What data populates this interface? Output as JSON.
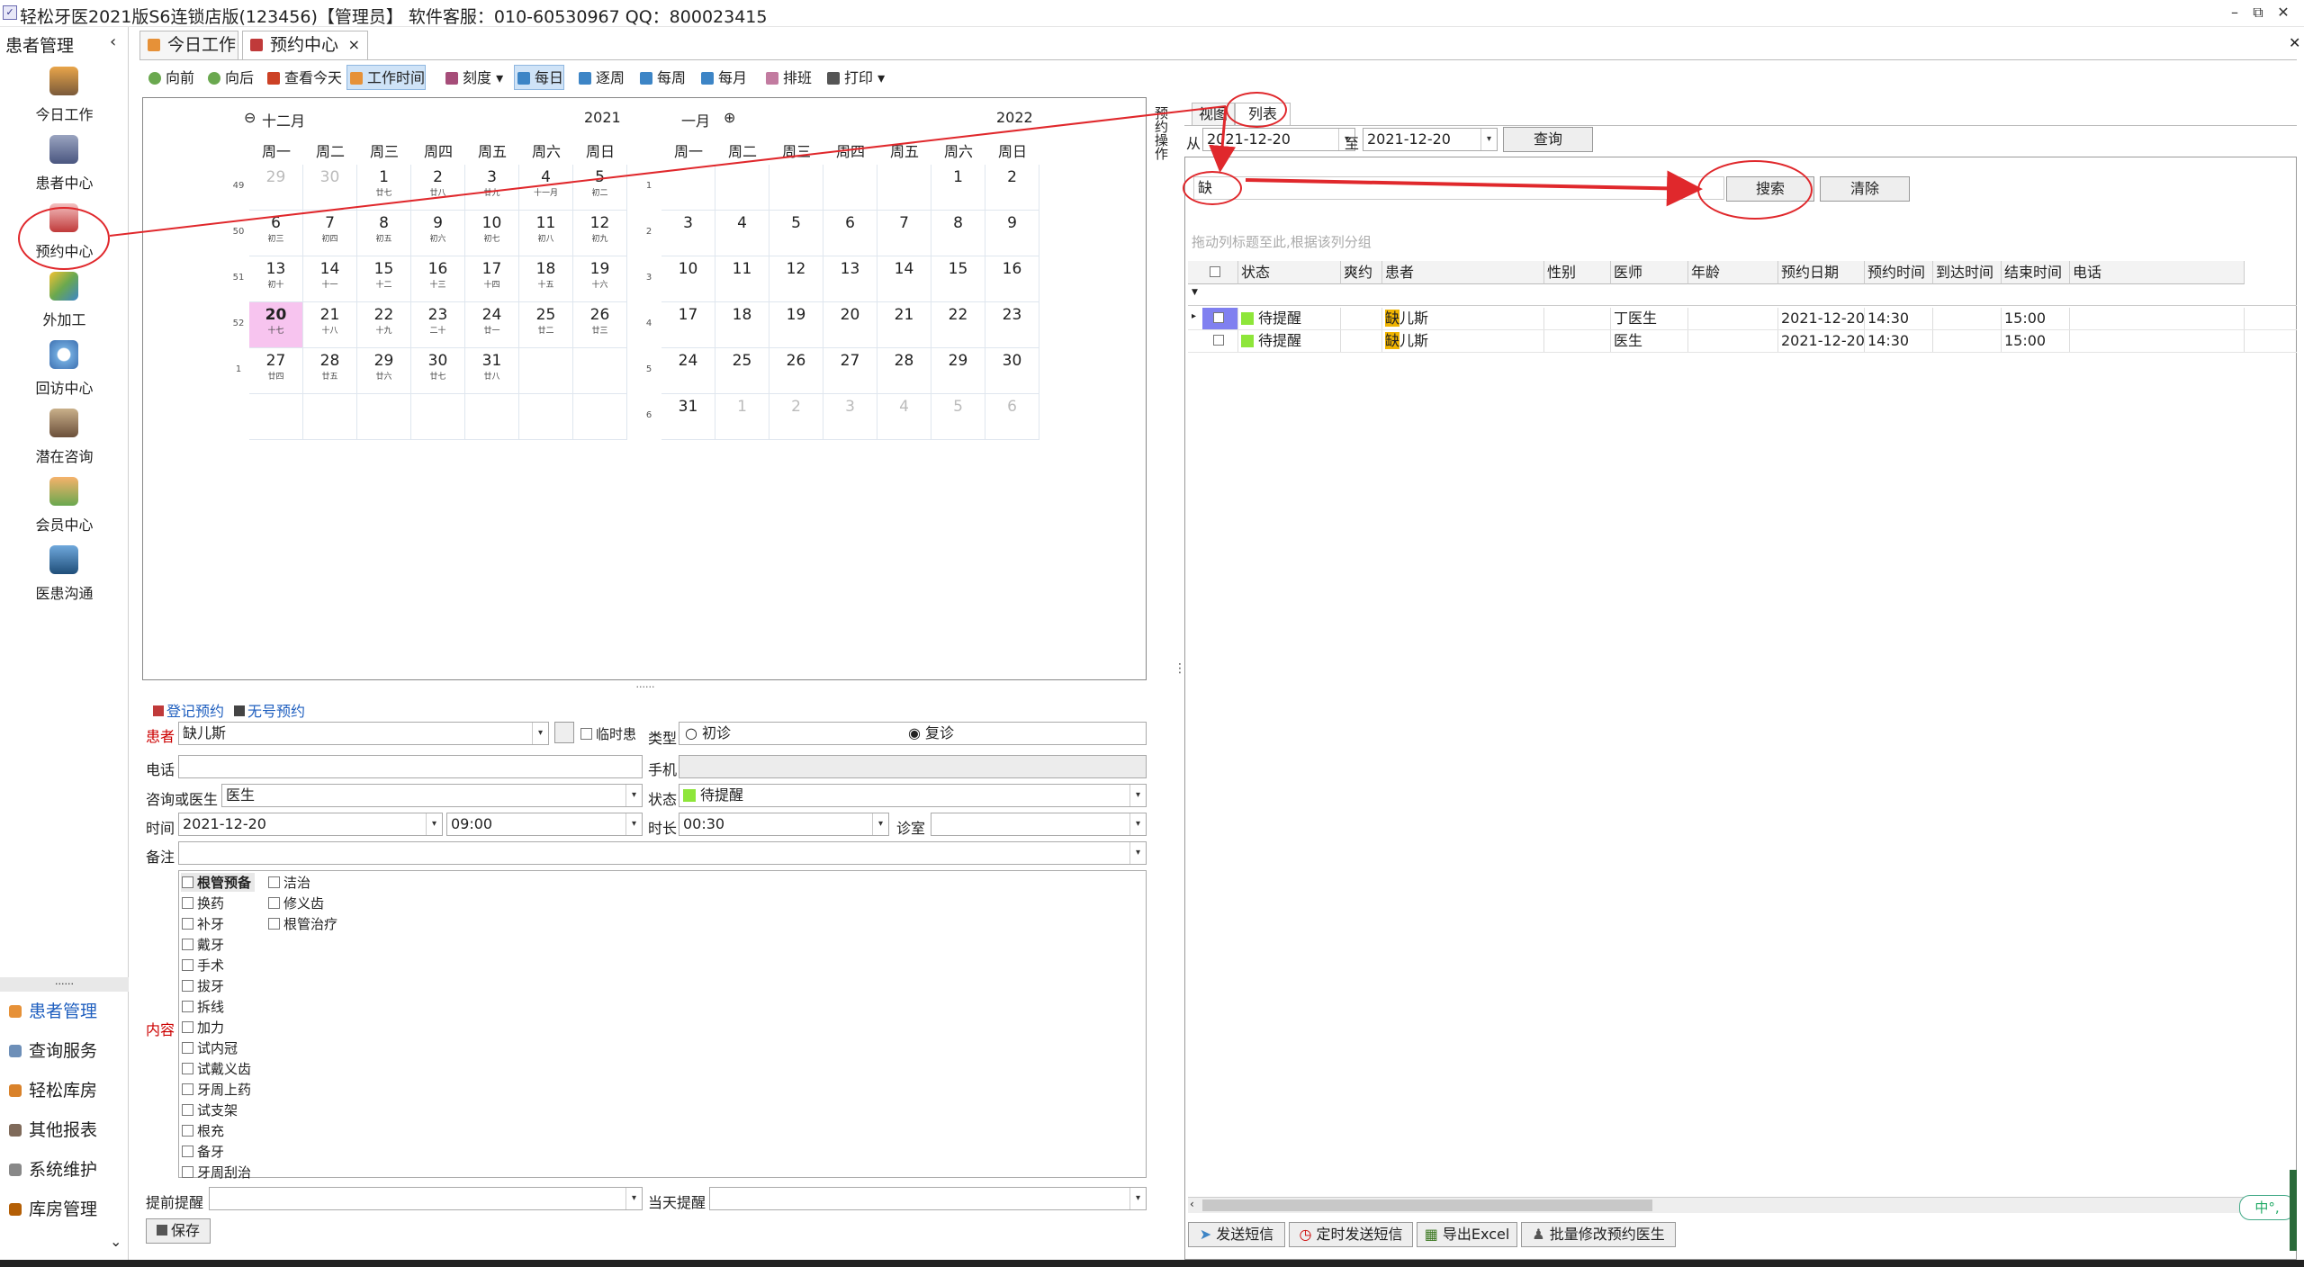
{
  "window": {
    "title": "轻松牙医2021版S6连锁店版(123456)【管理员】   软件客服：010-60530967 QQ：800023415"
  },
  "sidebar": {
    "header": "患者管理",
    "collapse": "‹",
    "items": [
      {
        "label": "今日工作"
      },
      {
        "label": "患者中心"
      },
      {
        "label": "预约中心"
      },
      {
        "label": "外加工"
      },
      {
        "label": "回访中心"
      },
      {
        "label": "潜在咨询"
      },
      {
        "label": "会员中心"
      },
      {
        "label": "医患沟通"
      }
    ],
    "grip": "......",
    "bottom": [
      {
        "label": "患者管理"
      },
      {
        "label": "查询服务"
      },
      {
        "label": "轻松库房"
      },
      {
        "label": "其他报表"
      },
      {
        "label": "系统维护"
      },
      {
        "label": "库房管理"
      }
    ],
    "expand": "⌄"
  },
  "tabs": [
    {
      "label": "今日工作"
    },
    {
      "label": "预约中心",
      "close": "×"
    }
  ],
  "toolbar": {
    "prev": "向前",
    "next": "向后",
    "today": "查看今天",
    "worktime": "工作时间",
    "scale": "刻度",
    "daily": "每日",
    "byweek": "逐周",
    "weekly": "每周",
    "monthly": "每月",
    "schedule": "排班",
    "print": "打印"
  },
  "calendar": {
    "left": {
      "month": "十二月",
      "year": "2021"
    },
    "right": {
      "month": "一月",
      "year": "2022"
    },
    "weekdays": [
      "周一",
      "周二",
      "周三",
      "周四",
      "周五",
      "周六",
      "周日"
    ],
    "left_weeks": [
      "49",
      "50",
      "51",
      "52",
      "1"
    ],
    "right_weeks": [
      "1",
      "2",
      "3",
      "4",
      "5",
      "6"
    ],
    "left_days": [
      [
        [
          "29",
          ""
        ],
        [
          "30",
          ""
        ],
        [
          "1",
          "廿七"
        ],
        [
          "2",
          "廿八"
        ],
        [
          "3",
          "廿九"
        ],
        [
          "4",
          "十一月"
        ],
        [
          "5",
          "初二"
        ]
      ],
      [
        [
          "6",
          "初三"
        ],
        [
          "7",
          "初四"
        ],
        [
          "8",
          "初五"
        ],
        [
          "9",
          "初六"
        ],
        [
          "10",
          "初七"
        ],
        [
          "11",
          "初八"
        ],
        [
          "12",
          "初九"
        ]
      ],
      [
        [
          "13",
          "初十"
        ],
        [
          "14",
          "十一"
        ],
        [
          "15",
          "十二"
        ],
        [
          "16",
          "十三"
        ],
        [
          "17",
          "十四"
        ],
        [
          "18",
          "十五"
        ],
        [
          "19",
          "十六"
        ]
      ],
      [
        [
          "20",
          "十七"
        ],
        [
          "21",
          "十八"
        ],
        [
          "22",
          "十九"
        ],
        [
          "23",
          "二十"
        ],
        [
          "24",
          "廿一"
        ],
        [
          "25",
          "廿二"
        ],
        [
          "26",
          "廿三"
        ]
      ],
      [
        [
          "27",
          "廿四"
        ],
        [
          "28",
          "廿五"
        ],
        [
          "29",
          "廿六"
        ],
        [
          "30",
          "廿七"
        ],
        [
          "31",
          "廿八"
        ],
        [
          "",
          ""
        ],
        [
          "",
          ""
        ]
      ],
      [
        [
          "",
          ""
        ],
        [
          "",
          ""
        ],
        [
          "",
          ""
        ],
        [
          "",
          ""
        ],
        [
          "",
          ""
        ],
        [
          "",
          ""
        ],
        [
          "",
          ""
        ]
      ]
    ],
    "right_days": [
      [
        "",
        "",
        "",
        "",
        "",
        "1",
        "2"
      ],
      [
        "3",
        "4",
        "5",
        "6",
        "7",
        "8",
        "9"
      ],
      [
        "10",
        "11",
        "12",
        "13",
        "14",
        "15",
        "16"
      ],
      [
        "17",
        "18",
        "19",
        "20",
        "21",
        "22",
        "23"
      ],
      [
        "24",
        "25",
        "26",
        "27",
        "28",
        "29",
        "30"
      ],
      [
        "31",
        "1",
        "2",
        "3",
        "4",
        "5",
        "6"
      ]
    ],
    "grip": "......"
  },
  "form": {
    "tab_register": "登记预约",
    "tab_noreg": "无号预约",
    "patient_label": "患者",
    "patient": "缺儿斯",
    "temp_label": "临时患",
    "type_label": "类型",
    "first": "初诊",
    "revisit": "复诊",
    "phone_label": "电话",
    "mobile_label": "手机",
    "doctor_label": "咨询或医生",
    "doctor": "医生",
    "status_label": "状态",
    "status": "待提醒",
    "time_label": "时间",
    "date": "2021-12-20",
    "time": "09:00",
    "duration_label": "时长",
    "duration": "00:30",
    "room_label": "诊室",
    "remark_label": "备注",
    "content_label": "内容",
    "items_col1": [
      "根管预备",
      "换药",
      "补牙",
      "戴牙",
      "手术",
      "拔牙",
      "拆线",
      "加力",
      "试内冠",
      "试戴义齿",
      "牙周上药",
      "试支架",
      "根充",
      "备牙",
      "牙周刮治"
    ],
    "items_col2": [
      "洁治",
      "修义齿",
      "根管治疗"
    ],
    "advance_label": "提前提醒",
    "sameday_label": "当天提醒",
    "save": "保存"
  },
  "right": {
    "vtab": "预约操作",
    "view_tab": "视图",
    "list_tab": "列表",
    "from_label": "从",
    "from": "2021-12-20",
    "to_label": "至",
    "to": "2021-12-20",
    "query": "查询",
    "search_value": "缺",
    "search": "搜索",
    "clear": "清除",
    "group_hint": "拖动列标题至此,根据该列分组",
    "columns": [
      "状态",
      "爽约",
      "患者",
      "性别",
      "医师",
      "年龄",
      "预约日期",
      "预约时间",
      "到达时间",
      "结束时间",
      "电话"
    ],
    "rows": [
      {
        "status": "待提醒",
        "patient": "缺儿斯",
        "doctor": "丁医生",
        "date": "2021-12-20",
        "time": "14:30",
        "end": "15:00"
      },
      {
        "status": "待提醒",
        "patient": "缺儿斯",
        "doctor": "医生",
        "date": "2021-12-20",
        "time": "14:30",
        "end": "15:00"
      }
    ],
    "send_sms": "发送短信",
    "timed_sms": "定时发送短信",
    "export": "导出Excel",
    "batch": "批量修改预约医生"
  },
  "ime": "中°,",
  "colors": {
    "status_green": "#8ee63a",
    "highlight": "#f0b400",
    "today": "#f7c4ef",
    "annot": "#e0282c"
  }
}
